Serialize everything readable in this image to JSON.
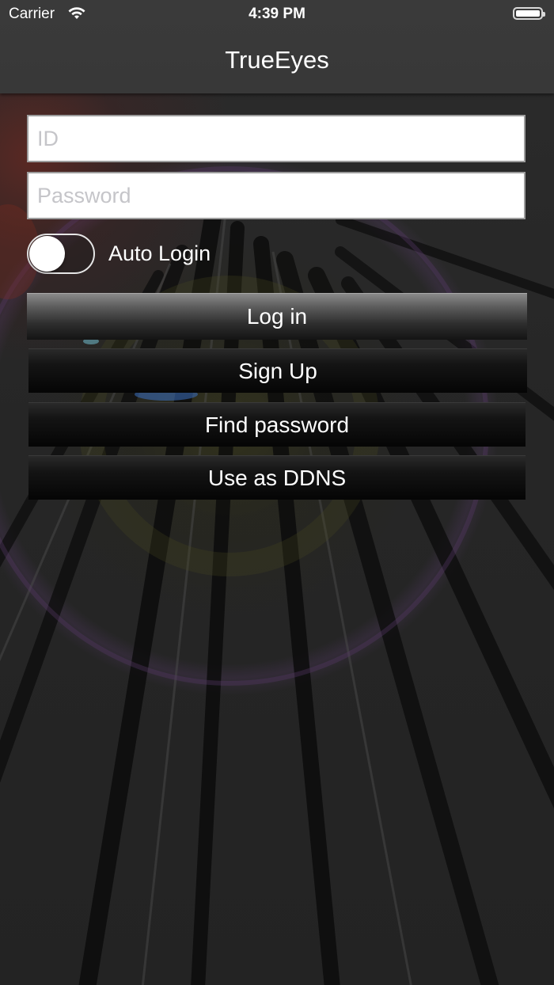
{
  "status_bar": {
    "carrier": "Carrier",
    "time": "4:39 PM",
    "battery_level": 1.0
  },
  "nav": {
    "title": "TrueEyes"
  },
  "form": {
    "id_placeholder": "ID",
    "password_placeholder": "Password",
    "id_value": "",
    "password_value": "",
    "auto_login_label": "Auto Login",
    "auto_login_on": false
  },
  "buttons": {
    "login": "Log in",
    "signup": "Sign Up",
    "find_password": "Find password",
    "ddns": "Use as DDNS"
  },
  "icons": {
    "wifi": "wifi-icon",
    "battery": "battery-icon"
  }
}
